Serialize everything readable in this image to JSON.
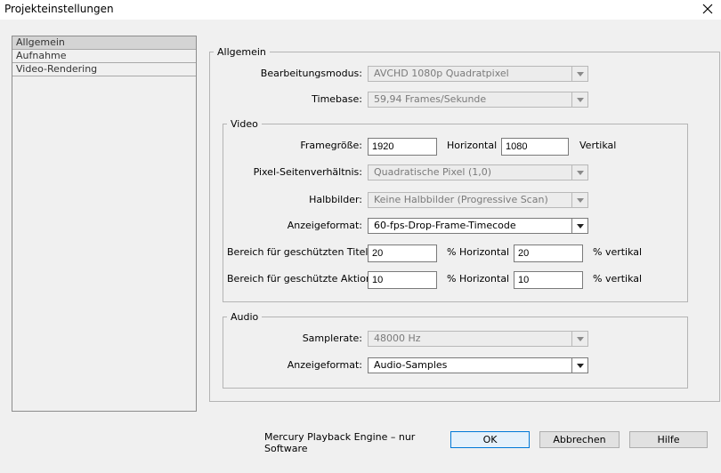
{
  "window": {
    "title": "Projekteinstellungen",
    "close_icon": "close-icon"
  },
  "sidebar": {
    "items": [
      {
        "label": "Allgemein",
        "active": true
      },
      {
        "label": "Aufnahme",
        "active": false
      },
      {
        "label": "Video-Rendering",
        "active": false
      }
    ]
  },
  "general": {
    "legend": "Allgemein",
    "editing_mode": {
      "label": "Bearbeitungsmodus:",
      "value": "AVCHD 1080p Quadratpixel"
    },
    "timebase": {
      "label": "Timebase:",
      "value": "59,94 Frames/Sekunde"
    }
  },
  "video": {
    "legend": "Video",
    "frame_size": {
      "label": "Framegröße:",
      "width": "1920",
      "horizontal_label": "Horizontal",
      "height": "1080",
      "vertical_label": "Vertikal"
    },
    "pixel_aspect": {
      "label": "Pixel-Seitenverhältnis:",
      "value": "Quadratische Pixel (1,0)"
    },
    "fields": {
      "label": "Halbbilder:",
      "value": "Keine Halbbilder (Progressive Scan)"
    },
    "display_format": {
      "label": "Anzeigeformat:",
      "value": "60-fps-Drop-Frame-Timecode"
    },
    "title_safe": {
      "label": "Bereich für geschützten Titel",
      "h": "20",
      "h_label": "% Horizontal",
      "v": "20",
      "v_label": "% vertikal"
    },
    "action_safe": {
      "label": "Bereich für geschützte Aktion",
      "h": "10",
      "h_label": "% Horizontal",
      "v": "10",
      "v_label": "% vertikal"
    }
  },
  "audio": {
    "legend": "Audio",
    "sample_rate": {
      "label": "Samplerate:",
      "value": "48000 Hz"
    },
    "display_format": {
      "label": "Anzeigeformat:",
      "value": "Audio-Samples"
    }
  },
  "footer": {
    "engine": "Mercury Playback Engine – nur Software",
    "ok": "OK",
    "cancel": "Abbrechen",
    "help": "Hilfe"
  }
}
